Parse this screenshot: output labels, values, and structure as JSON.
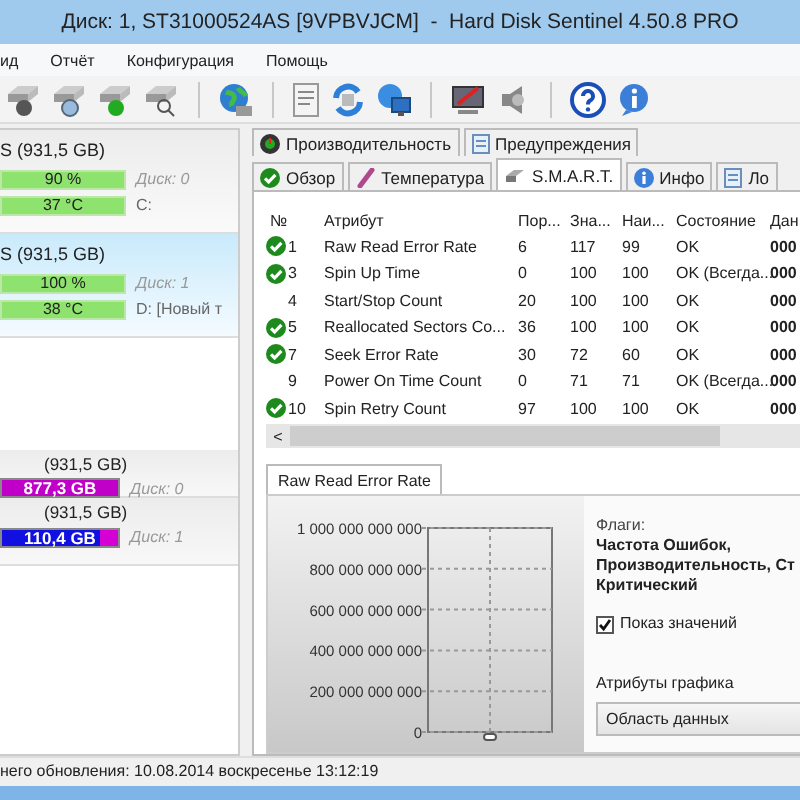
{
  "window": {
    "title": "Диск: 1, ST31000524AS [9VPBVJCM]  -  Hard Disk Sentinel 4.50.8 PRO"
  },
  "menu": [
    {
      "label": "ид"
    },
    {
      "label": "Отчёт"
    },
    {
      "label": "Конфигурация"
    },
    {
      "label": "Помощь"
    }
  ],
  "disks": [
    {
      "title": "S (931,5 GB)",
      "selected": false,
      "health": "90 %",
      "disk": "Диск: 0",
      "temperature": "37 °C",
      "drive": "C:"
    },
    {
      "title": "S (931,5 GB)",
      "selected": true,
      "health": "100 %",
      "disk": "Диск: 1",
      "temperature": "38 °C",
      "drive": "D: [Новый т"
    }
  ],
  "partitions": [
    {
      "size": "(931,5 GB)",
      "used": "877,3 GB",
      "color": "#c000c8",
      "level": 1,
      "disk": "Диск: 0"
    },
    {
      "size": "(931,5 GB)",
      "used": "110,4 GB",
      "color": "#1010e0",
      "level": 0.84,
      "disk": "Диск: 1"
    }
  ],
  "tabs_top": [
    {
      "label": "Производительность",
      "selected": false
    },
    {
      "label": "Предупреждения",
      "selected": false
    }
  ],
  "tabs": [
    {
      "label": "Обзор",
      "selected": false
    },
    {
      "label": "Температура",
      "selected": false
    },
    {
      "label": "S.M.A.R.T.",
      "selected": true
    },
    {
      "label": "Инфо",
      "selected": false
    },
    {
      "label": "Ло",
      "selected": false
    }
  ],
  "smart": {
    "columns": [
      "№",
      "Атрибут",
      "Пор...",
      "Зна...",
      "Наи...",
      "Состояние",
      "Дан"
    ],
    "rows": [
      {
        "ok": true,
        "cells": [
          "1",
          "Raw Read Error Rate",
          "6",
          "117",
          "99",
          "OK",
          "000"
        ]
      },
      {
        "ok": true,
        "cells": [
          "3",
          "Spin Up Time",
          "0",
          "100",
          "100",
          "OK (Всегда...",
          "000"
        ]
      },
      {
        "ok": false,
        "cells": [
          "4",
          "Start/Stop Count",
          "20",
          "100",
          "100",
          "OK",
          "000"
        ]
      },
      {
        "ok": true,
        "cells": [
          "5",
          "Reallocated Sectors Co...",
          "36",
          "100",
          "100",
          "OK",
          "000"
        ]
      },
      {
        "ok": true,
        "cells": [
          "7",
          "Seek Error Rate",
          "30",
          "72",
          "60",
          "OK",
          "000"
        ]
      },
      {
        "ok": false,
        "cells": [
          "9",
          "Power On Time Count",
          "0",
          "71",
          "71",
          "OK (Всегда...",
          "000"
        ]
      },
      {
        "ok": true,
        "cells": [
          "10",
          "Spin Retry Count",
          "97",
          "100",
          "100",
          "OK",
          "000"
        ]
      }
    ],
    "scroll_left": "<"
  },
  "detail": {
    "tab": "Raw Read Error Rate",
    "y_axis_labels": [
      "1 000 000 000 000",
      "800 000 000 000",
      "600 000 000 000",
      "400 000 000 000",
      "200 000 000 000",
      "0"
    ],
    "flags_label": "Флаги:",
    "flags": [
      "Частота Ошибок,",
      "Производительность, Ст",
      "Критический"
    ],
    "show_values": {
      "label": "Показ значений",
      "checked": true
    },
    "graph_label": "Атрибуты графика",
    "graph_select": "Область данных"
  },
  "status_bar": "него обновления: 10.08.2014 воскресенье 13:12:19"
}
